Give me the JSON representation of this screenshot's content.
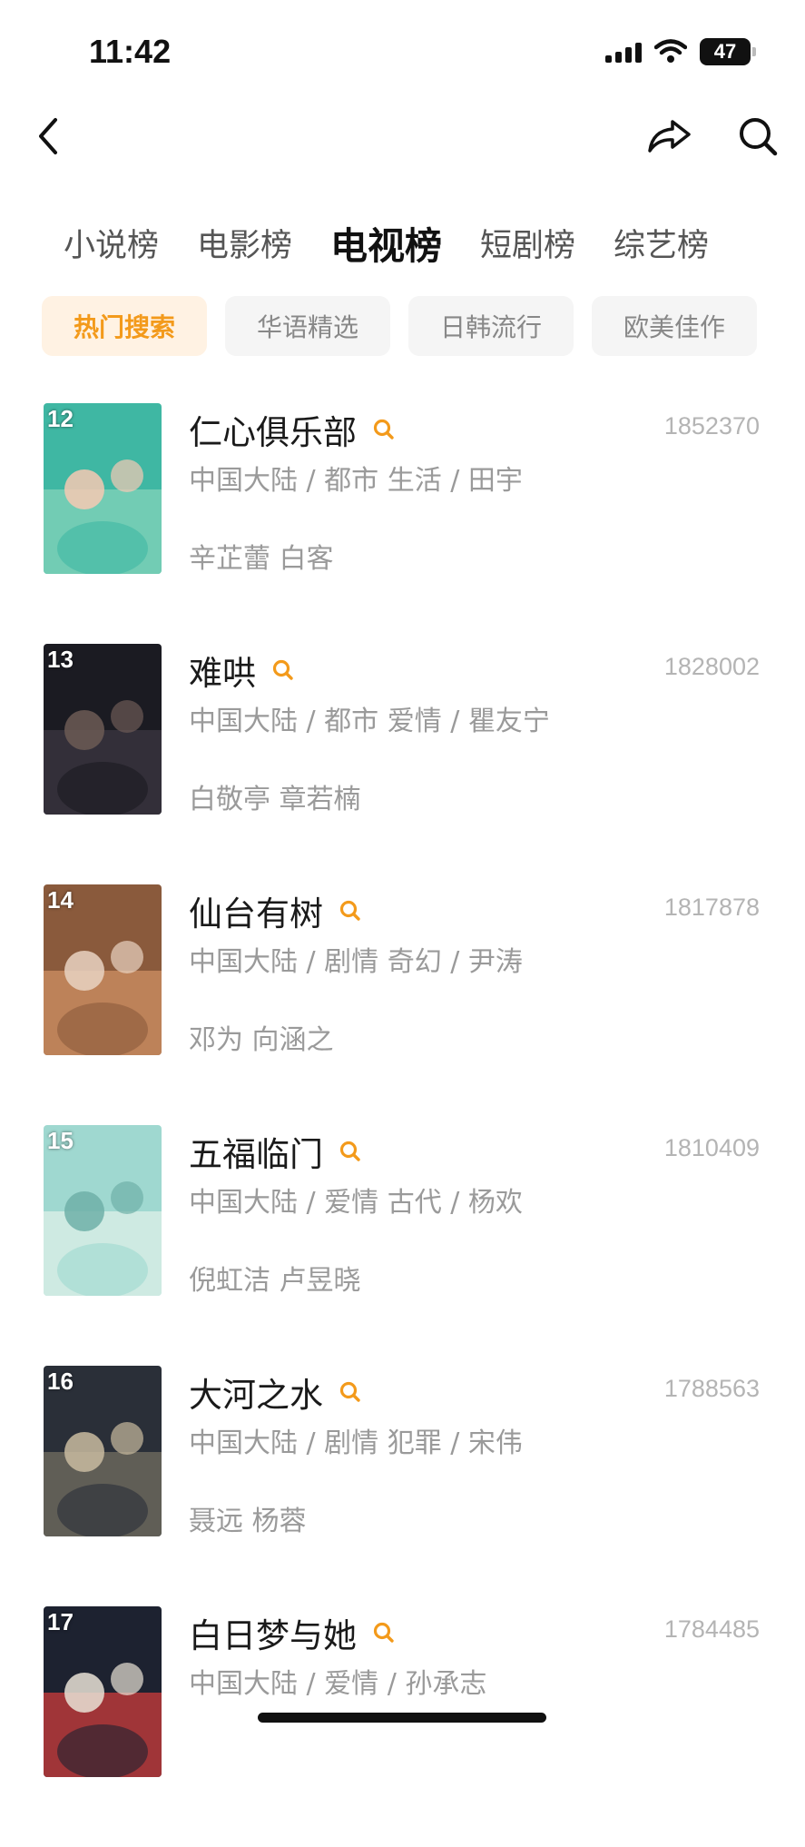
{
  "status": {
    "time": "11:42",
    "battery": "47"
  },
  "nav": {
    "back_icon": "chevron-left-icon",
    "share_icon": "share-icon",
    "search_icon": "search-icon"
  },
  "category_tabs": [
    {
      "label": "小说榜",
      "active": false
    },
    {
      "label": "电影榜",
      "active": false
    },
    {
      "label": "电视榜",
      "active": true
    },
    {
      "label": "短剧榜",
      "active": false
    },
    {
      "label": "综艺榜",
      "active": false
    }
  ],
  "filter_chips": [
    {
      "label": "热门搜索",
      "active": true
    },
    {
      "label": "华语精选",
      "active": false
    },
    {
      "label": "日韩流行",
      "active": false
    },
    {
      "label": "欧美佳作",
      "active": false
    }
  ],
  "colors": {
    "accent": "#f39a1b",
    "chip_bg": "#f5f5f5",
    "chip_active_bg": "#fff2e3"
  },
  "items": [
    {
      "rank": "12",
      "title": "仁心俱乐部",
      "count": "1852370",
      "meta": "中国大陆 / 都市 生活 / 田宇",
      "cast": "辛芷蕾 白客",
      "poster_colors": [
        "#3fb7a3",
        "#7fd1b8",
        "#f6c9b3"
      ]
    },
    {
      "rank": "13",
      "title": "难哄",
      "count": "1828002",
      "meta": "中国大陆 / 都市 爱情 / 瞿友宁",
      "cast": "白敬亭 章若楠",
      "poster_colors": [
        "#1b1b22",
        "#3a3440",
        "#6c5a55"
      ]
    },
    {
      "rank": "14",
      "title": "仙台有树",
      "count": "1817878",
      "meta": "中国大陆 / 剧情 奇幻 / 尹涛",
      "cast": "邓为 向涵之",
      "poster_colors": [
        "#8a5a3c",
        "#c98c60",
        "#e9d3c2"
      ]
    },
    {
      "rank": "15",
      "title": "五福临门",
      "count": "1810409",
      "meta": "中国大陆 / 爱情 古代 / 杨欢",
      "cast": "倪虹洁 卢昱晓",
      "poster_colors": [
        "#9fd8d0",
        "#d9efe6",
        "#6fb0a8"
      ]
    },
    {
      "rank": "16",
      "title": "大河之水",
      "count": "1788563",
      "meta": "中国大陆 / 剧情 犯罪 / 宋伟",
      "cast": "聂远 杨蓉",
      "poster_colors": [
        "#2a2f38",
        "#6e6a5e",
        "#c9bba0"
      ]
    },
    {
      "rank": "17",
      "title": "白日梦与她",
      "count": "1784485",
      "meta": "中国大陆 / 爱情 / 孙承志",
      "cast": "",
      "poster_colors": [
        "#1d2230",
        "#c23b3b",
        "#e9e2d6"
      ]
    }
  ]
}
